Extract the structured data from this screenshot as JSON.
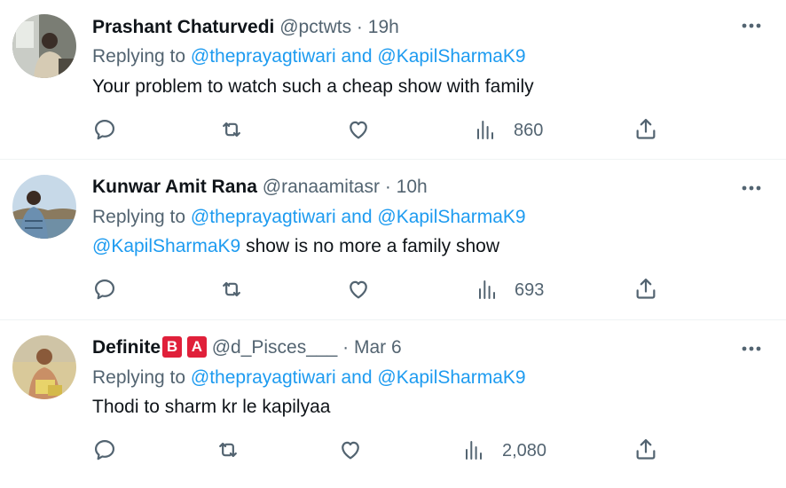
{
  "tweets": [
    {
      "name": "Prashant Chaturvedi",
      "handle": "@pctwts",
      "separator": "·",
      "time": "19h",
      "replying_prefix": "Replying to",
      "replying_mention_1": "@theprayagtiwari",
      "replying_and": "and",
      "replying_mention_2": "@KapilSharmaK9",
      "body_mention": "",
      "body_text": "Your problem to watch such a cheap show with family",
      "views": "860"
    },
    {
      "name": "Kunwar Amit Rana",
      "handle": "@ranaamitasr",
      "separator": "·",
      "time": "10h",
      "replying_prefix": "Replying to",
      "replying_mention_1": "@theprayagtiwari",
      "replying_and": "and",
      "replying_mention_2": "@KapilSharmaK9",
      "body_mention": "@KapilSharmaK9",
      "body_text": " show is no more a family show",
      "views": "693"
    },
    {
      "name": "Definite",
      "badge_1": "B",
      "badge_2": "A",
      "handle": "@d_Pisces___",
      "separator": "·",
      "time": "Mar 6",
      "replying_prefix": "Replying to",
      "replying_mention_1": "@theprayagtiwari",
      "replying_and": "and",
      "replying_mention_2": "@KapilSharmaK9",
      "body_mention": "",
      "body_text": "Thodi to sharm kr le kapilyaa",
      "views": "2,080"
    }
  ],
  "colors": {
    "text": "#0f1419",
    "secondary": "#536471",
    "link": "#1d9bf0",
    "badge": "#e0203a",
    "divider": "#eff3f4"
  },
  "icons": [
    "reply-icon",
    "retweet-icon",
    "like-icon",
    "views-icon",
    "share-icon",
    "more-icon"
  ]
}
